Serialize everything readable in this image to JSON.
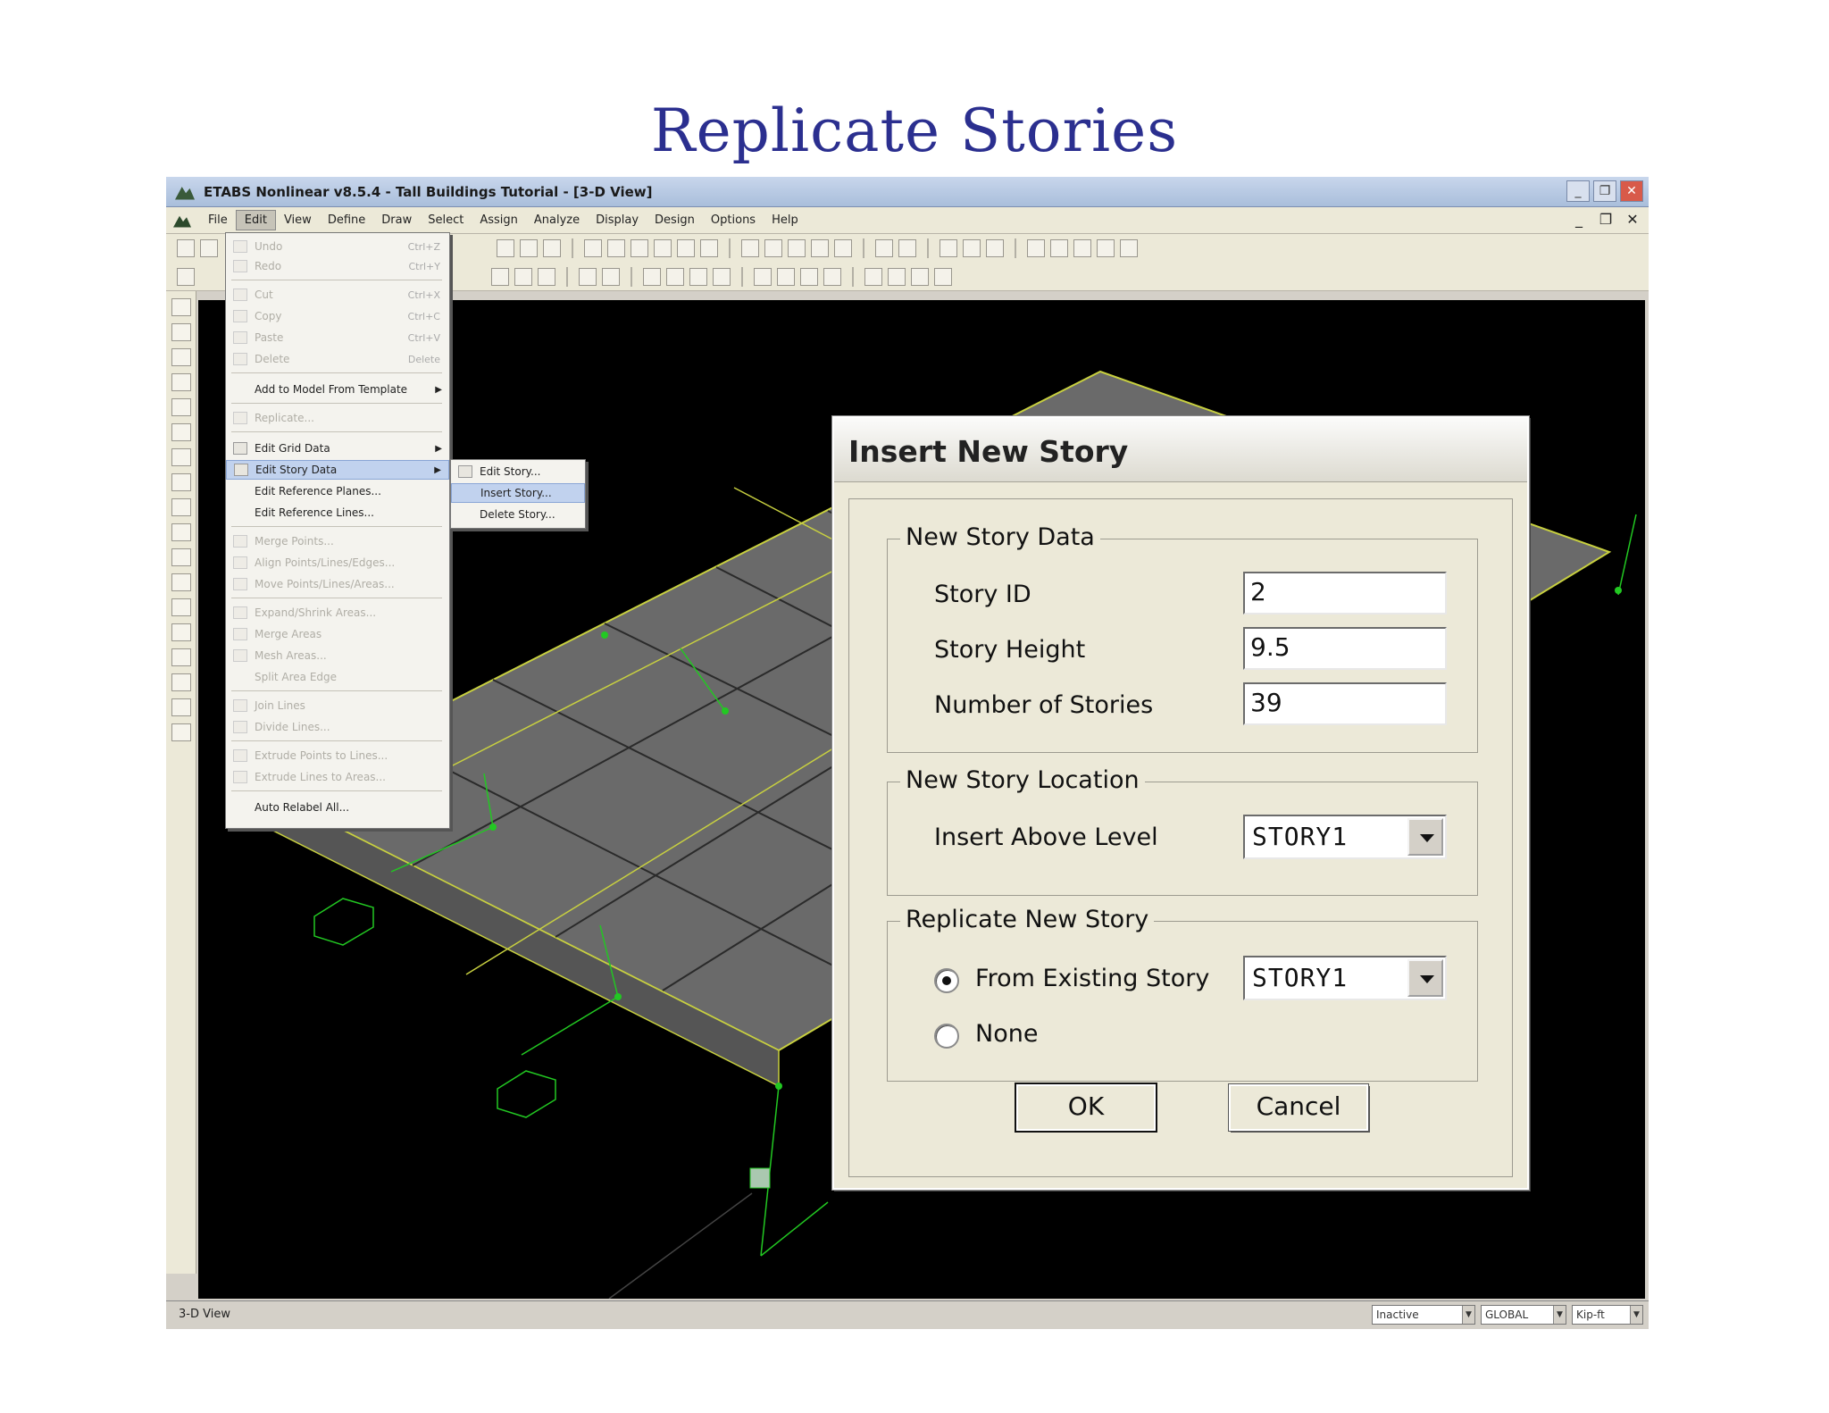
{
  "slide": {
    "title": "Replicate Stories"
  },
  "window": {
    "title": "ETABS Nonlinear v8.5.4 - Tall Buildings Tutorial - [3-D View]"
  },
  "menubar": [
    "File",
    "Edit",
    "View",
    "Define",
    "Draw",
    "Select",
    "Assign",
    "Analyze",
    "Display",
    "Design",
    "Options",
    "Help"
  ],
  "edit_menu": {
    "items": [
      {
        "label": "Undo",
        "shortcut": "Ctrl+Z",
        "disabled": true,
        "icon": "undo-icon"
      },
      {
        "label": "Redo",
        "shortcut": "Ctrl+Y",
        "disabled": true,
        "icon": "redo-icon"
      },
      {
        "label": "Cut",
        "shortcut": "Ctrl+X",
        "disabled": true,
        "icon": "cut-icon"
      },
      {
        "label": "Copy",
        "shortcut": "Ctrl+C",
        "disabled": true,
        "icon": "copy-icon"
      },
      {
        "label": "Paste",
        "shortcut": "Ctrl+V",
        "disabled": true,
        "icon": "paste-icon"
      },
      {
        "label": "Delete",
        "shortcut": "Delete",
        "disabled": true,
        "icon": "delete-icon"
      },
      {
        "label": "Add to Model From Template",
        "disabled": false,
        "submenu": true
      },
      {
        "label": "Replicate...",
        "disabled": true,
        "icon": "replicate-icon"
      },
      {
        "label": "Edit Grid Data",
        "disabled": false,
        "submenu": true,
        "icon": "grid-icon"
      },
      {
        "label": "Edit Story Data",
        "disabled": false,
        "submenu": true,
        "highlighted": true,
        "icon": "story-icon"
      },
      {
        "label": "Edit Reference Planes...",
        "disabled": false
      },
      {
        "label": "Edit Reference Lines...",
        "disabled": false
      },
      {
        "label": "Merge Points...",
        "disabled": true,
        "icon": "merge-icon"
      },
      {
        "label": "Align Points/Lines/Edges...",
        "disabled": true,
        "icon": "align-icon"
      },
      {
        "label": "Move Points/Lines/Areas...",
        "disabled": true,
        "icon": "move-icon"
      },
      {
        "label": "Expand/Shrink Areas...",
        "disabled": true,
        "icon": "expand-icon"
      },
      {
        "label": "Merge Areas",
        "disabled": true,
        "icon": "merge-areas-icon"
      },
      {
        "label": "Mesh Areas...",
        "disabled": true,
        "icon": "mesh-icon"
      },
      {
        "label": "Split Area Edge",
        "disabled": true
      },
      {
        "label": "Join Lines",
        "disabled": true,
        "icon": "join-icon"
      },
      {
        "label": "Divide Lines...",
        "disabled": true,
        "icon": "divide-icon"
      },
      {
        "label": "Extrude Points to Lines...",
        "disabled": true,
        "icon": "extrude-points-icon"
      },
      {
        "label": "Extrude Lines to Areas...",
        "disabled": true,
        "icon": "extrude-lines-icon"
      },
      {
        "label": "Auto Relabel All...",
        "disabled": false
      }
    ]
  },
  "story_submenu": [
    {
      "label": "Edit Story...",
      "icon": "story-icon"
    },
    {
      "label": "Insert Story...",
      "highlighted": true
    },
    {
      "label": "Delete Story..."
    }
  ],
  "dialog": {
    "title": "Insert New Story",
    "groups": {
      "data": "New Story Data",
      "location": "New Story Location",
      "replicate": "Replicate New Story"
    },
    "fields": {
      "story_id_label": "Story ID",
      "story_id": "2",
      "story_height_label": "Story Height",
      "story_height": "9.5",
      "num_stories_label": "Number of Stories",
      "num_stories": "39",
      "insert_above_label": "Insert Above Level",
      "insert_above": "STORY1",
      "from_existing_label": "From Existing Story",
      "from_existing": "STORY1",
      "none_label": "None"
    },
    "replicate_choice": "from_existing",
    "ok": "OK",
    "cancel": "Cancel"
  },
  "status": {
    "view": "3-D View",
    "mode": "Inactive",
    "coord": "GLOBAL",
    "units": "Kip-ft"
  },
  "colors": {
    "title_blue": "#2b2f8f",
    "slab": "#6a6a6a",
    "edge_yellow": "#c8d040",
    "support_green": "#22c822"
  }
}
